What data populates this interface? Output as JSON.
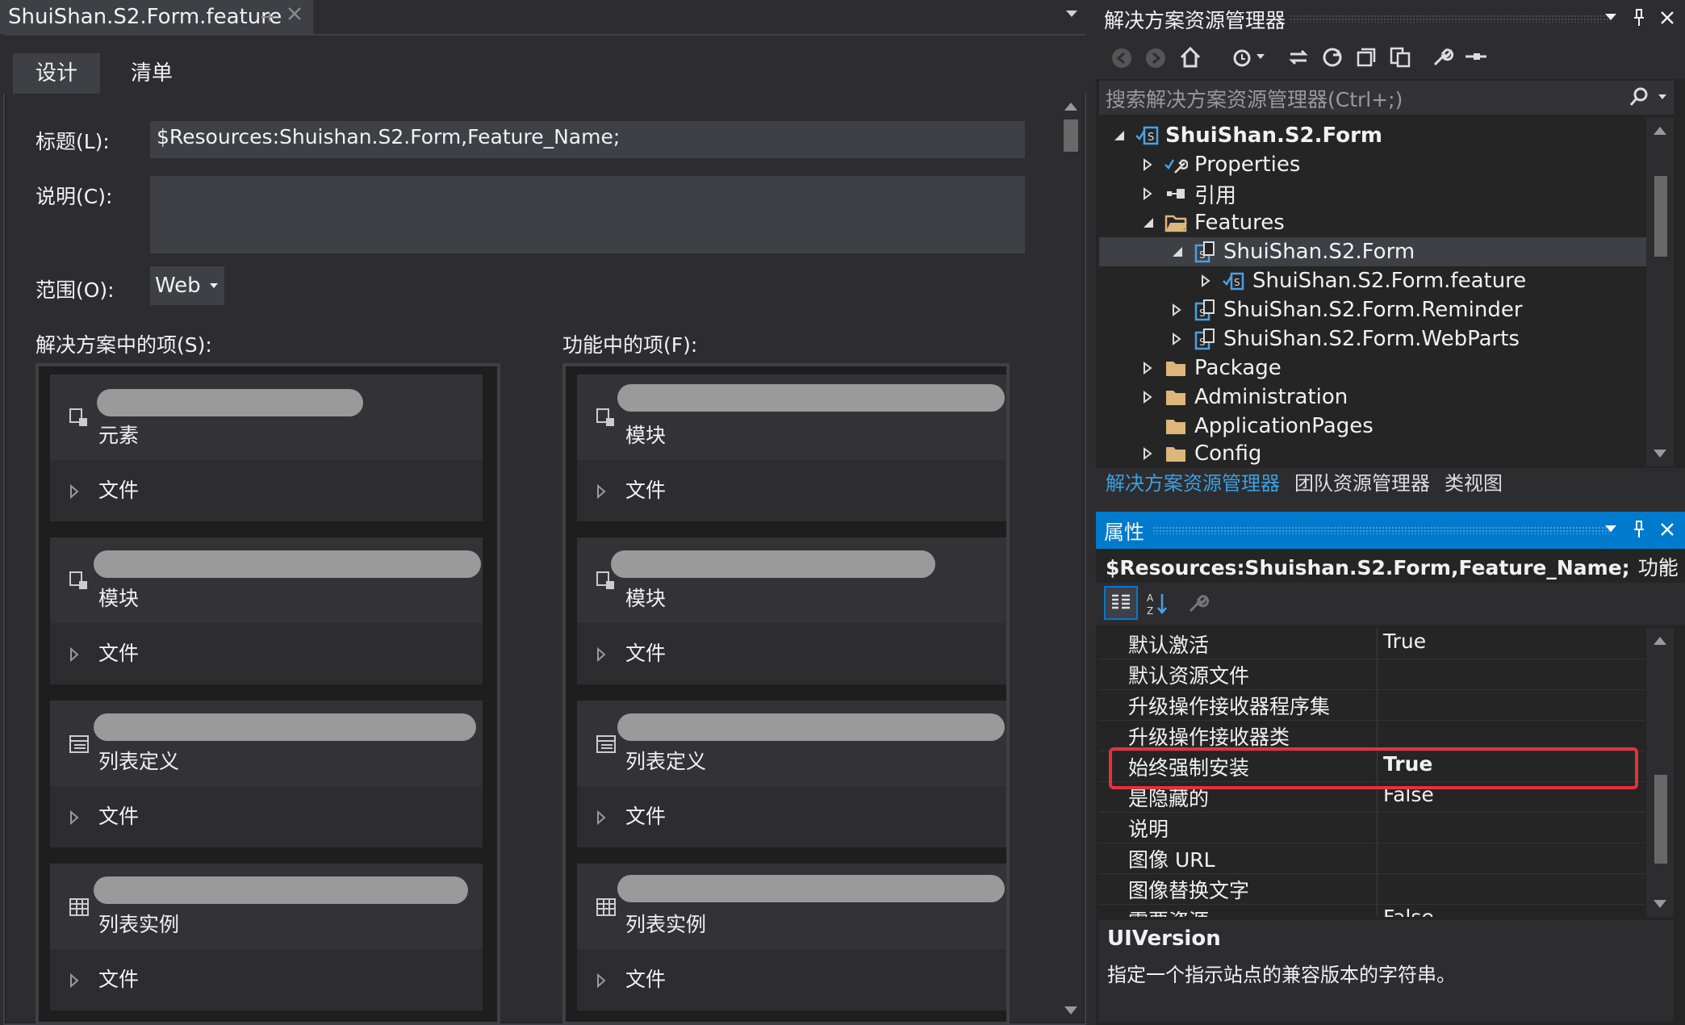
{
  "document": {
    "tab_title": "ShuiShan.S2.Form.feature",
    "tabs": [
      "设计",
      "清单"
    ]
  },
  "form": {
    "title_label": "标题(L):",
    "title_value": "$Resources:Shuishan.S2.Form,Feature_Name;",
    "description_label": "说明(C):",
    "description_value": "",
    "scope_label": "范围(O):",
    "scope_value": "Web",
    "solution_items_label": "解决方案中的项(S):",
    "feature_items_label": "功能中的项(F):"
  },
  "solution_items": [
    {
      "type": "元素",
      "files": "文件",
      "icon": "element-icon"
    },
    {
      "type": "模块",
      "files": "文件",
      "icon": "module-icon"
    },
    {
      "type": "列表定义",
      "files": "文件",
      "icon": "list-definition-icon"
    },
    {
      "type": "列表实例",
      "files": "文件",
      "icon": "list-instance-icon"
    }
  ],
  "feature_items": [
    {
      "type": "模块",
      "files": "文件",
      "icon": "module-icon"
    },
    {
      "type": "模块",
      "files": "文件",
      "icon": "module-icon"
    },
    {
      "type": "列表定义",
      "files": "文件",
      "icon": "list-definition-icon"
    },
    {
      "type": "列表实例",
      "files": "文件",
      "icon": "list-instance-icon"
    }
  ],
  "solution_explorer": {
    "title": "解决方案资源管理器",
    "search_placeholder": "搜索解决方案资源管理器(Ctrl+;)",
    "tree": {
      "project": "ShuiShan.S2.Form",
      "properties": "Properties",
      "references": "引用",
      "features": "Features",
      "feature_node": "ShuiShan.S2.Form",
      "feature_file": "ShuiShan.S2.Form.feature",
      "reminder": "ShuiShan.S2.Form.Reminder",
      "webparts": "ShuiShan.S2.Form.WebParts",
      "package": "Package",
      "administration": "Administration",
      "application_pages": "ApplicationPages",
      "config": "Config"
    },
    "bottom_tabs": [
      "解决方案资源管理器",
      "团队资源管理器",
      "类视图"
    ]
  },
  "properties": {
    "title": "属性",
    "object_name": "$Resources:Shuishan.S2.Form,Feature_Name;",
    "object_type": "功能",
    "rows": [
      {
        "name": "默认激活",
        "value": "True"
      },
      {
        "name": "默认资源文件",
        "value": ""
      },
      {
        "name": "升级操作接收器程序集",
        "value": ""
      },
      {
        "name": "升级操作接收器类",
        "value": ""
      },
      {
        "name": "始终强制安装",
        "value": "True"
      },
      {
        "name": "是隐藏的",
        "value": "False"
      },
      {
        "name": "说明",
        "value": ""
      },
      {
        "name": "图像 URL",
        "value": ""
      },
      {
        "name": "图像替换文字",
        "value": ""
      },
      {
        "name": "需要资源",
        "value": "False"
      }
    ],
    "description_title": "UIVersion",
    "description_text": "指定一个指示站点的兼容版本的字符串。"
  },
  "colors": {
    "accent": "#007acc",
    "highlight": "#e8303c",
    "background": "#2d2d30"
  }
}
